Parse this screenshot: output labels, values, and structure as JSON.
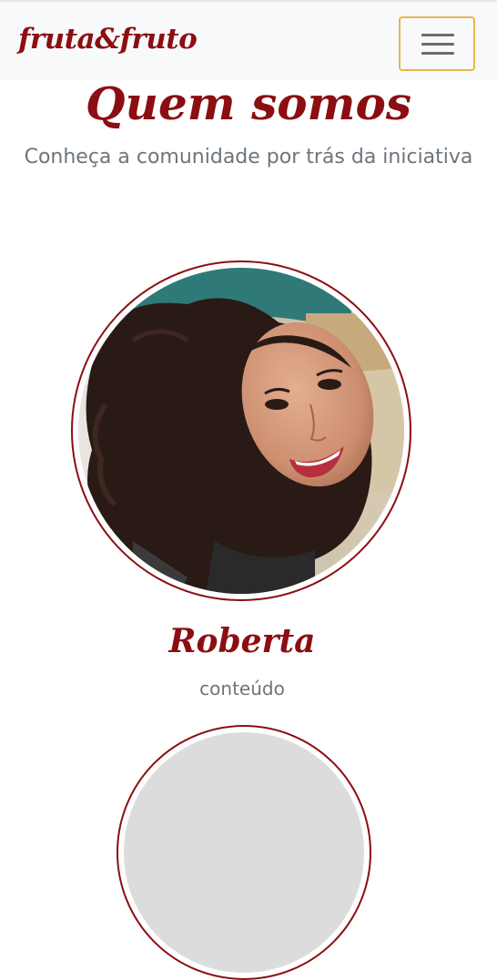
{
  "navbar": {
    "brand": "fruta&fruto",
    "toggle_icon": "hamburger-menu-icon",
    "toggle_border_color": "#e7b84f"
  },
  "hero": {
    "title": "Quem somos",
    "subtitle": "Conheça a comunidade por trás da iniciativa"
  },
  "team": {
    "members": [
      {
        "name": "Roberta",
        "role": "conteúdo"
      }
    ]
  },
  "colors": {
    "brand": "#8b0e12",
    "muted_text": "#6c757d",
    "navbar_bg": "#f8f9fa"
  }
}
